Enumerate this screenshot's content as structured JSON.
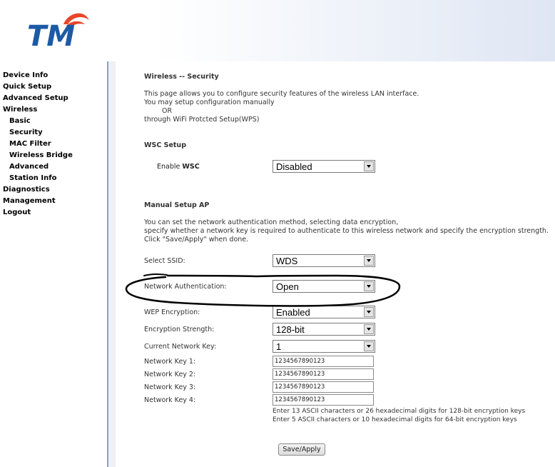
{
  "logo": {
    "text": "TM"
  },
  "sidebar": {
    "items": [
      {
        "label": "Device Info",
        "sub": false
      },
      {
        "label": "Quick Setup",
        "sub": false
      },
      {
        "label": "Advanced Setup",
        "sub": false
      },
      {
        "label": "Wireless",
        "sub": false
      },
      {
        "label": "Basic",
        "sub": true
      },
      {
        "label": "Security",
        "sub": true
      },
      {
        "label": "MAC Filter",
        "sub": true
      },
      {
        "label": "Wireless Bridge",
        "sub": true
      },
      {
        "label": "Advanced",
        "sub": true
      },
      {
        "label": "Station Info",
        "sub": true
      },
      {
        "label": "Diagnostics",
        "sub": false
      },
      {
        "label": "Management",
        "sub": false
      },
      {
        "label": "Logout",
        "sub": false
      }
    ]
  },
  "page": {
    "title": "Wireless -- Security",
    "intro_line1": "This page allows you to configure security features of the wireless LAN interface.",
    "intro_line2": "You may setup configuration manually",
    "intro_or": "OR",
    "intro_line3": "through WiFi Protcted Setup(WPS)"
  },
  "wsc": {
    "heading": "WSC Setup",
    "label_prefix": "Enable ",
    "label_bold": "WSC",
    "value": "Disabled"
  },
  "manual": {
    "heading": "Manual Setup AP",
    "desc1": "You can set the network authentication method, selecting data encryption,",
    "desc2": "specify whether a network key is required to authenticate to this wireless network and specify the encryption strength.",
    "desc3": "Click \"Save/Apply\" when done.",
    "ssid_label": "Select SSID:",
    "ssid_value": "WDS",
    "auth_label": "Network Authentication:",
    "auth_value": "Open",
    "wep_label": "WEP Encryption:",
    "wep_value": "Enabled",
    "strength_label": "Encryption Strength:",
    "strength_value": "128-bit",
    "current_key_label": "Current Network Key:",
    "current_key_value": "1",
    "key1_label": "Network Key 1:",
    "key1_value": "1234567890123",
    "key2_label": "Network Key 2:",
    "key2_value": "1234567890123",
    "key3_label": "Network Key 3:",
    "key3_value": "1234567890123",
    "key4_label": "Network Key 4:",
    "key4_value": "1234567890123",
    "hint1": "Enter 13 ASCII characters or 26 hexadecimal digits for 128-bit encryption keys",
    "hint2": "Enter 5 ASCII characters or 10 hexadecimal digits for 64-bit encryption keys",
    "save_label": "Save/Apply"
  },
  "colors": {
    "logo_blue": "#1c5aa6",
    "logo_orange": "#e8462a",
    "divider": "#7fa3cf"
  }
}
